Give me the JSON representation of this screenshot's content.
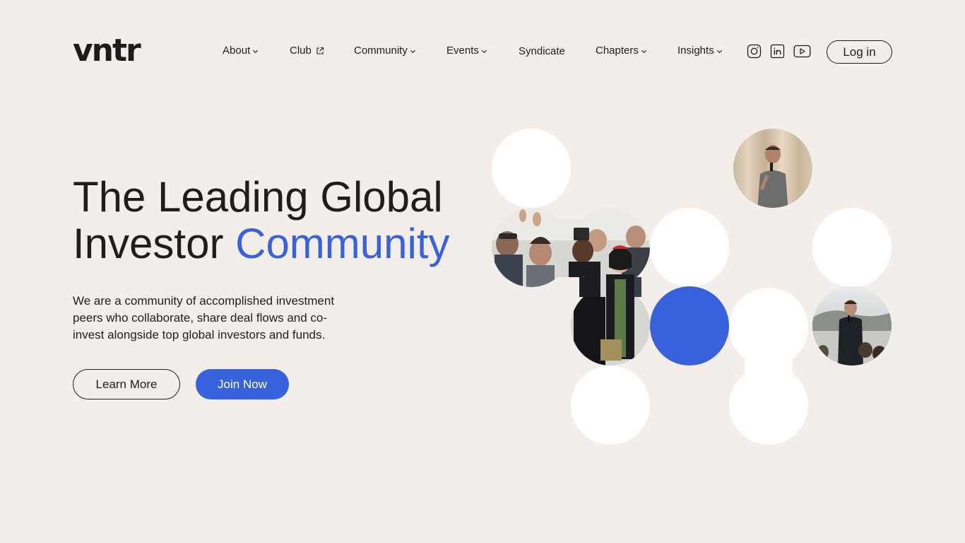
{
  "brand": {
    "logo_text": "vntr"
  },
  "nav": {
    "items": [
      {
        "label": "About",
        "icon": "chevron-down-icon"
      },
      {
        "label": "Club",
        "icon": "external-link-icon"
      },
      {
        "label": "Community",
        "icon": "chevron-down-icon"
      },
      {
        "label": "Events",
        "icon": "chevron-down-icon"
      },
      {
        "label": "Syndicate"
      },
      {
        "label": "Chapters",
        "icon": "chevron-down-icon"
      },
      {
        "label": "Insights",
        "icon": "chevron-down-icon"
      }
    ],
    "social": [
      "instagram-icon",
      "linkedin-icon",
      "youtube-icon"
    ],
    "login_label": "Log in"
  },
  "hero": {
    "headline_line1": "The Leading Global",
    "headline_line2_plain": "Investor ",
    "headline_line2_accent": "Community",
    "description": "We are a community of accomplished investment peers who collaborate, share deal flows and co-invest alongside top global investors and funds.",
    "learn_more_label": "Learn More",
    "join_now_label": "Join Now"
  },
  "colors": {
    "background": "#f3eee9",
    "accent": "#3762dc",
    "text": "#1e1e1e",
    "circle": "#ffffff"
  }
}
